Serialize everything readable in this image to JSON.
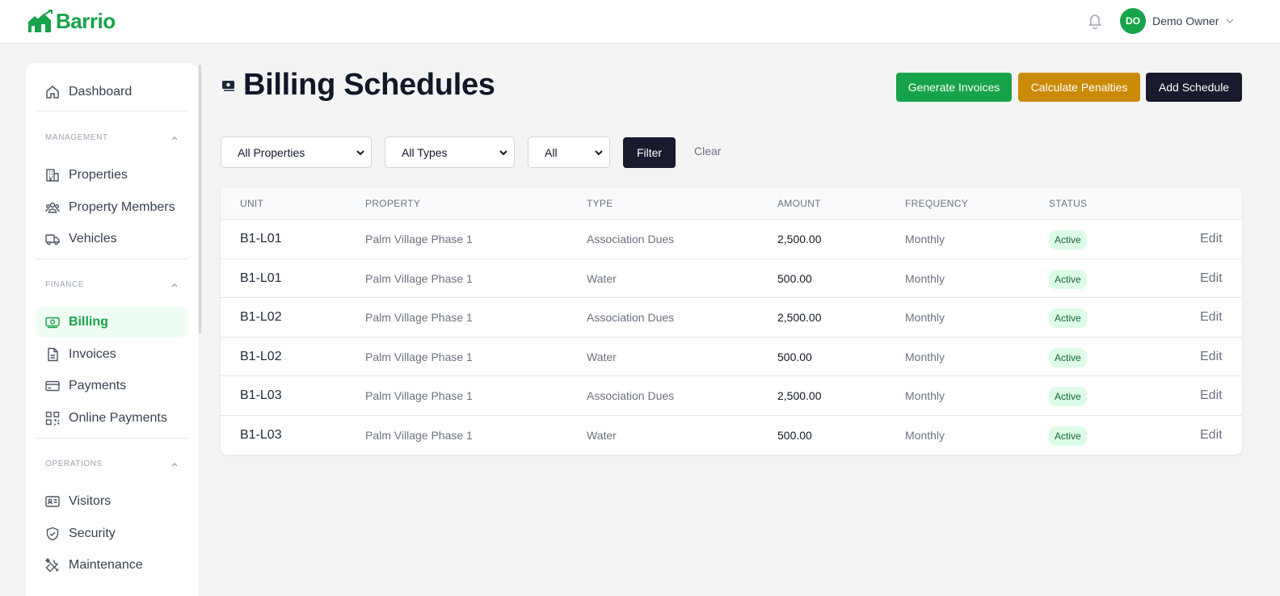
{
  "brand": {
    "name": "Barrio",
    "color": "#16a34a"
  },
  "topbar": {
    "notification_icon": "bell-icon",
    "user": {
      "initials": "DO",
      "name": "Demo Owner"
    }
  },
  "sidebar": {
    "dashboard": "Dashboard",
    "sections": [
      {
        "label": "MANAGEMENT",
        "items": [
          {
            "label": "Properties",
            "icon": "building-icon"
          },
          {
            "label": "Property Members",
            "icon": "users-icon"
          },
          {
            "label": "Vehicles",
            "icon": "truck-icon"
          }
        ]
      },
      {
        "label": "FINANCE",
        "items": [
          {
            "label": "Billing",
            "icon": "banknote-icon",
            "active": true
          },
          {
            "label": "Invoices",
            "icon": "document-icon"
          },
          {
            "label": "Payments",
            "icon": "credit-card-icon"
          },
          {
            "label": "Online Payments",
            "icon": "qr-code-icon"
          }
        ]
      },
      {
        "label": "OPERATIONS",
        "items": [
          {
            "label": "Visitors",
            "icon": "id-card-icon"
          },
          {
            "label": "Security",
            "icon": "shield-check-icon"
          },
          {
            "label": "Maintenance",
            "icon": "tools-icon"
          }
        ]
      }
    ]
  },
  "page": {
    "title": "Billing Schedules",
    "actions": {
      "generate": "Generate Invoices",
      "penalties": "Calculate Penalties",
      "add": "Add Schedule"
    },
    "filters": {
      "property": "All Properties",
      "type": "All Types",
      "status": "All",
      "filter_label": "Filter",
      "clear_label": "Clear"
    }
  },
  "table": {
    "headers": {
      "unit": "UNIT",
      "property": "PROPERTY",
      "type": "TYPE",
      "amount": "AMOUNT",
      "frequency": "FREQUENCY",
      "status": "STATUS"
    },
    "rows": [
      {
        "unit": "B1-L01",
        "property": "Palm Village Phase 1",
        "type": "Association Dues",
        "amount": "2,500.00",
        "frequency": "Monthly",
        "status": "Active",
        "action": "Edit"
      },
      {
        "unit": "B1-L01",
        "property": "Palm Village Phase 1",
        "type": "Water",
        "amount": "500.00",
        "frequency": "Monthly",
        "status": "Active",
        "action": "Edit"
      },
      {
        "unit": "B1-L02",
        "property": "Palm Village Phase 1",
        "type": "Association Dues",
        "amount": "2,500.00",
        "frequency": "Monthly",
        "status": "Active",
        "action": "Edit"
      },
      {
        "unit": "B1-L02",
        "property": "Palm Village Phase 1",
        "type": "Water",
        "amount": "500.00",
        "frequency": "Monthly",
        "status": "Active",
        "action": "Edit"
      },
      {
        "unit": "B1-L03",
        "property": "Palm Village Phase 1",
        "type": "Association Dues",
        "amount": "2,500.00",
        "frequency": "Monthly",
        "status": "Active",
        "action": "Edit"
      },
      {
        "unit": "B1-L03",
        "property": "Palm Village Phase 1",
        "type": "Water",
        "amount": "500.00",
        "frequency": "Monthly",
        "status": "Active",
        "action": "Edit"
      }
    ]
  }
}
